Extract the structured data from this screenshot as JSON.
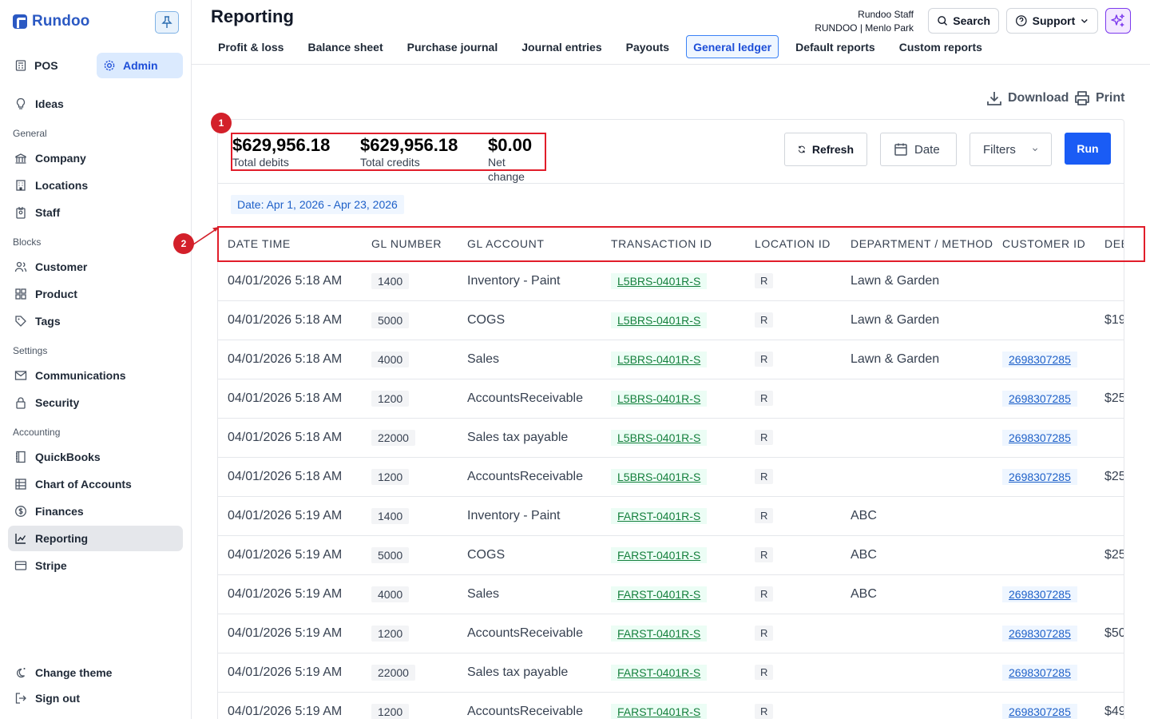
{
  "brand": {
    "name": "Rundoo"
  },
  "switcher": {
    "pos": "POS",
    "admin": "Admin"
  },
  "sidebar": {
    "ideas": "Ideas",
    "sections": {
      "general": "General",
      "blocks": "Blocks",
      "settings": "Settings",
      "accounting": "Accounting"
    },
    "items": {
      "company": "Company",
      "locations": "Locations",
      "staff": "Staff",
      "customer": "Customer",
      "product": "Product",
      "tags": "Tags",
      "communications": "Communications",
      "security": "Security",
      "quickbooks": "QuickBooks",
      "chart_of_accounts": "Chart of Accounts",
      "finances": "Finances",
      "reporting": "Reporting",
      "stripe": "Stripe"
    },
    "footer": {
      "change_theme": "Change theme",
      "sign_out": "Sign out"
    }
  },
  "header": {
    "title": "Reporting",
    "tabs": [
      "Profit & loss",
      "Balance sheet",
      "Purchase journal",
      "Journal entries",
      "Payouts",
      "General ledger",
      "Default reports",
      "Custom reports"
    ],
    "active_tab": "General ledger",
    "user_name": "Rundoo Staff",
    "user_location": "RUNDOO | Menlo Park",
    "search_label": "Search",
    "support_label": "Support"
  },
  "actions": {
    "download": "Download",
    "print": "Print"
  },
  "summary": {
    "total_debits": "$629,956.18",
    "total_debits_label": "Total debits",
    "total_credits": "$629,956.18",
    "total_credits_label": "Total credits",
    "net_change": "$0.00",
    "net_change_label": "Net change"
  },
  "controls": {
    "refresh": "Refresh",
    "date": "Date",
    "filters": "Filters",
    "run": "Run"
  },
  "date_filter": "Date: Apr 1, 2026 - Apr 23, 2026",
  "table": {
    "columns": [
      "DATE TIME",
      "GL NUMBER",
      "GL ACCOUNT",
      "TRANSACTION ID",
      "LOCATION ID",
      "DEPARTMENT / METHOD",
      "CUSTOMER ID",
      "DEBIT"
    ],
    "rows": [
      {
        "datetime": "04/01/2026 5:18 AM",
        "gl_number": "1400",
        "gl_account": "Inventory - Paint",
        "txn": "L5BRS-0401R-S",
        "loc": "R",
        "dept": "Lawn & Garden",
        "cust": "",
        "debit": ""
      },
      {
        "datetime": "04/01/2026 5:18 AM",
        "gl_number": "5000",
        "gl_account": "COGS",
        "txn": "L5BRS-0401R-S",
        "loc": "R",
        "dept": "Lawn & Garden",
        "cust": "",
        "debit": "$19"
      },
      {
        "datetime": "04/01/2026 5:18 AM",
        "gl_number": "4000",
        "gl_account": "Sales",
        "txn": "L5BRS-0401R-S",
        "loc": "R",
        "dept": "Lawn & Garden",
        "cust": "2698307285",
        "debit": ""
      },
      {
        "datetime": "04/01/2026 5:18 AM",
        "gl_number": "1200",
        "gl_account": "AccountsReceivable",
        "txn": "L5BRS-0401R-S",
        "loc": "R",
        "dept": "",
        "cust": "2698307285",
        "debit": "$25"
      },
      {
        "datetime": "04/01/2026 5:18 AM",
        "gl_number": "22000",
        "gl_account": "Sales tax payable",
        "txn": "L5BRS-0401R-S",
        "loc": "R",
        "dept": "",
        "cust": "2698307285",
        "debit": ""
      },
      {
        "datetime": "04/01/2026 5:18 AM",
        "gl_number": "1200",
        "gl_account": "AccountsReceivable",
        "txn": "L5BRS-0401R-S",
        "loc": "R",
        "dept": "",
        "cust": "2698307285",
        "debit": "$25"
      },
      {
        "datetime": "04/01/2026 5:19 AM",
        "gl_number": "1400",
        "gl_account": "Inventory - Paint",
        "txn": "FARST-0401R-S",
        "loc": "R",
        "dept": "ABC",
        "cust": "",
        "debit": ""
      },
      {
        "datetime": "04/01/2026 5:19 AM",
        "gl_number": "5000",
        "gl_account": "COGS",
        "txn": "FARST-0401R-S",
        "loc": "R",
        "dept": "ABC",
        "cust": "",
        "debit": "$25"
      },
      {
        "datetime": "04/01/2026 5:19 AM",
        "gl_number": "4000",
        "gl_account": "Sales",
        "txn": "FARST-0401R-S",
        "loc": "R",
        "dept": "ABC",
        "cust": "2698307285",
        "debit": ""
      },
      {
        "datetime": "04/01/2026 5:19 AM",
        "gl_number": "1200",
        "gl_account": "AccountsReceivable",
        "txn": "FARST-0401R-S",
        "loc": "R",
        "dept": "",
        "cust": "2698307285",
        "debit": "$50"
      },
      {
        "datetime": "04/01/2026 5:19 AM",
        "gl_number": "22000",
        "gl_account": "Sales tax payable",
        "txn": "FARST-0401R-S",
        "loc": "R",
        "dept": "",
        "cust": "2698307285",
        "debit": ""
      },
      {
        "datetime": "04/01/2026 5:19 AM",
        "gl_number": "1200",
        "gl_account": "AccountsReceivable",
        "txn": "FARST-0401R-S",
        "loc": "R",
        "dept": "",
        "cust": "2698307285",
        "debit": "$49"
      }
    ]
  },
  "annotations": {
    "marker_1": "1",
    "marker_2": "2"
  },
  "colors": {
    "brand": "#2b59c3",
    "accent": "#1a5cf5",
    "highlight": "#e11d2a",
    "link_green": "#15803d",
    "link_blue": "#1e60c8"
  },
  "icons": [
    "pin-icon",
    "pos-icon",
    "gear-icon",
    "lightbulb-icon",
    "building-icon",
    "map-building-icon",
    "badge-icon",
    "users-icon",
    "grid-icon",
    "tag-icon",
    "mail-icon",
    "lock-icon",
    "book-icon",
    "table-icon",
    "dollar-icon",
    "chart-line-icon",
    "card-icon",
    "theme-icon",
    "sign-out-icon",
    "search-icon",
    "help-circle-icon",
    "chevron-down-icon",
    "sparkle-icon",
    "download-icon",
    "printer-icon",
    "refresh-icon",
    "calendar-icon"
  ]
}
